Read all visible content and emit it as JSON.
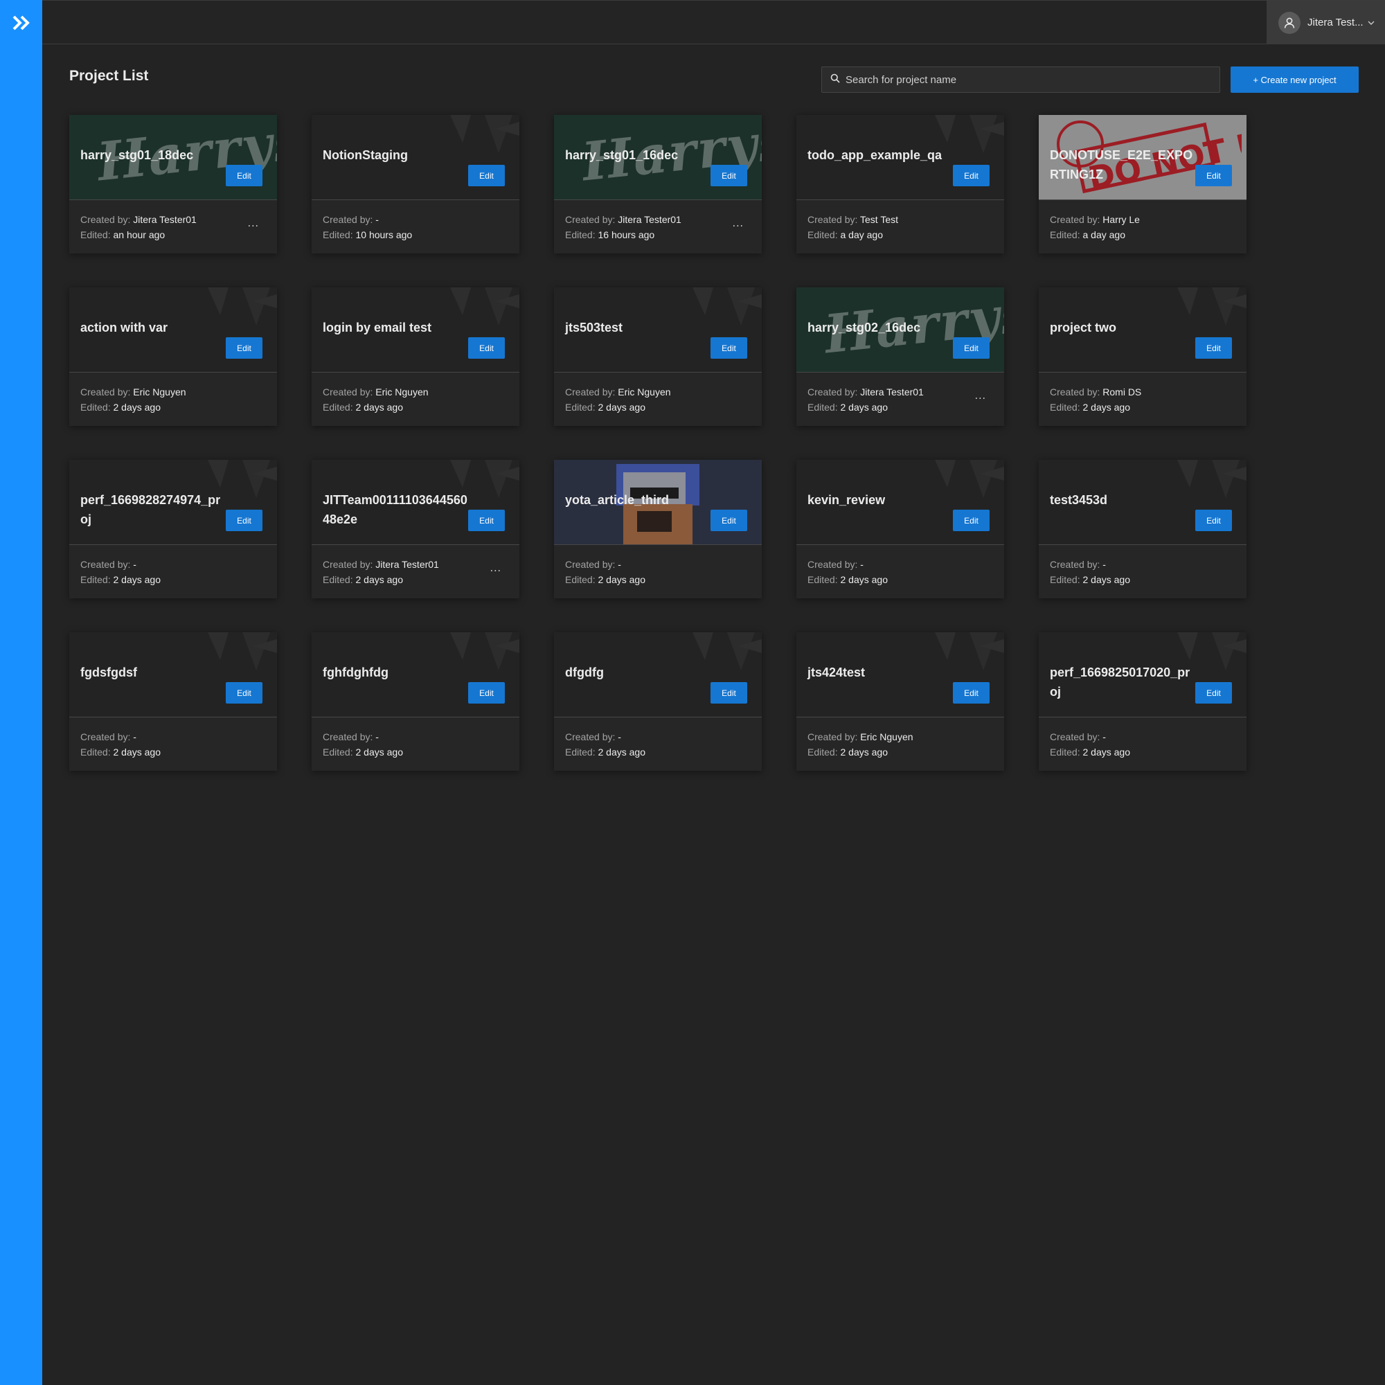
{
  "brand": {
    "accent": "#1890ff",
    "button_blue": "#1677d2",
    "logo_icon": "double-chevron-right-icon"
  },
  "header": {
    "user_name": "Jitera Test..."
  },
  "page": {
    "title": "Project List"
  },
  "search": {
    "placeholder": "Search for project name"
  },
  "actions": {
    "create_label": "+ Create new project"
  },
  "labels": {
    "created_by": "Created by:",
    "edited": "Edited:",
    "edit": "Edit",
    "more": "..."
  },
  "projects": [
    {
      "name": "harry_stg01_18dec",
      "created_by": "Jitera Tester01",
      "edited": "an hour ago",
      "thumb": "harrys",
      "more": true
    },
    {
      "name": "NotionStaging",
      "created_by": "-",
      "edited": "10 hours ago",
      "thumb": "default",
      "more": false
    },
    {
      "name": "harry_stg01_16dec",
      "created_by": "Jitera Tester01",
      "edited": "16 hours ago",
      "thumb": "harrys",
      "more": true
    },
    {
      "name": "todo_app_example_qa",
      "created_by": "Test Test",
      "edited": "a day ago",
      "thumb": "default",
      "more": false
    },
    {
      "name": "DONOTUSE_E2E_EXPORTING1Z",
      "created_by": "Harry Le",
      "edited": "a day ago",
      "thumb": "donotuse",
      "more": false
    },
    {
      "name": "action with var",
      "created_by": "Eric Nguyen",
      "edited": "2 days ago",
      "thumb": "default",
      "more": false
    },
    {
      "name": "login by email test",
      "created_by": "Eric Nguyen",
      "edited": "2 days ago",
      "thumb": "default",
      "more": false
    },
    {
      "name": "jts503test",
      "created_by": "Eric Nguyen",
      "edited": "2 days ago",
      "thumb": "default",
      "more": false
    },
    {
      "name": "harry_stg02_16dec",
      "created_by": "Jitera Tester01",
      "edited": "2 days ago",
      "thumb": "harrys",
      "more": true
    },
    {
      "name": "project two",
      "created_by": "Romi DS",
      "edited": "2 days ago",
      "thumb": "default",
      "more": false
    },
    {
      "name": "perf_1669828274974_proj",
      "created_by": "-",
      "edited": "2 days ago",
      "thumb": "default",
      "more": false
    },
    {
      "name": "JITTeam0011110364456048e2e",
      "created_by": "Jitera Tester01",
      "edited": "2 days ago",
      "thumb": "default",
      "more": true
    },
    {
      "name": "yota_article_third",
      "created_by": "-",
      "edited": "2 days ago",
      "thumb": "pixel",
      "more": false
    },
    {
      "name": "kevin_review",
      "created_by": "-",
      "edited": "2 days ago",
      "thumb": "default",
      "more": false
    },
    {
      "name": "test3453d",
      "created_by": "-",
      "edited": "2 days ago",
      "thumb": "default",
      "more": false
    },
    {
      "name": "fgdsfgdsf",
      "created_by": "-",
      "edited": "2 days ago",
      "thumb": "default",
      "more": false
    },
    {
      "name": "fghfdghfdg",
      "created_by": "-",
      "edited": "2 days ago",
      "thumb": "default",
      "more": false
    },
    {
      "name": "dfgdfg",
      "created_by": "-",
      "edited": "2 days ago",
      "thumb": "default",
      "more": false
    },
    {
      "name": "jts424test",
      "created_by": "Eric Nguyen",
      "edited": "2 days ago",
      "thumb": "default",
      "more": false
    },
    {
      "name": "perf_1669825017020_proj",
      "created_by": "-",
      "edited": "2 days ago",
      "thumb": "default",
      "more": false
    }
  ]
}
